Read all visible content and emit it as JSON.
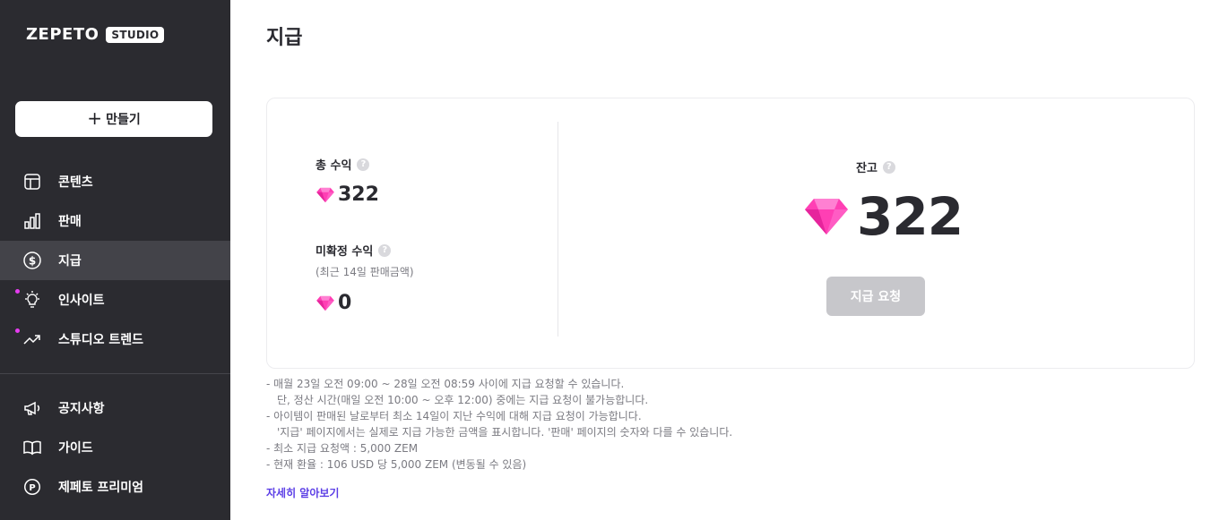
{
  "app": {
    "logo_word": "ZEPETO",
    "logo_badge": "STUDIO"
  },
  "sidebar": {
    "create_label": "만들기",
    "items": [
      {
        "label": "콘텐츠",
        "icon": "layout-icon"
      },
      {
        "label": "판매",
        "icon": "bar-chart-icon"
      },
      {
        "label": "지급",
        "icon": "dollar-circle-icon",
        "active": true
      },
      {
        "label": "인사이트",
        "icon": "lightbulb-icon",
        "dot": true
      },
      {
        "label": "스튜디오 트렌드",
        "icon": "trend-icon",
        "dot": true
      }
    ],
    "bottom_items": [
      {
        "label": "공지사항",
        "icon": "megaphone-icon"
      },
      {
        "label": "가이드",
        "icon": "book-icon"
      },
      {
        "label": "제페토 프리미엄",
        "icon": "premium-icon",
        "icon_text": "P"
      }
    ]
  },
  "page": {
    "title": "지급"
  },
  "card": {
    "total_label": "총 수익",
    "total_value": "322",
    "pending_label": "미확정 수익",
    "pending_sub": "(최근 14일 판매금액)",
    "pending_value": "0",
    "balance_label": "잔고",
    "balance_value": "322",
    "pay_button": "지급 요청",
    "help_glyph": "?"
  },
  "notes": [
    {
      "text": "- 매월 23일 오전 09:00 ~ 28일 오전 08:59 사이에 지급 요청할 수 있습니다.",
      "indent": false
    },
    {
      "text": "단, 정산 시간(매일 오전 10:00 ~ 오후 12:00) 중에는 지급 요청이 불가능합니다.",
      "indent": true
    },
    {
      "text": "- 아이템이 판매된 날로부터 최소 14일이 지난 수익에 대해 지급 요청이 가능합니다.",
      "indent": false
    },
    {
      "text": "'지급' 페이지에서는 실제로 지급 가능한 금액을 표시합니다. '판매' 페이지의 숫자와 다를 수 있습니다.",
      "indent": true
    },
    {
      "text": "- 최소 지급 요청액 : 5,000 ZEM",
      "indent": false
    },
    {
      "text": "- 현재 환율 : 106 USD 당 5,000 ZEM (변동될 수 있음)",
      "indent": false
    }
  ],
  "learn_more": "자세히 알아보기",
  "colors": {
    "sidebar_bg": "#2b2b30",
    "active_bg": "#434349",
    "accent_dot": "#e63cf0",
    "gem": "#ff3fb4",
    "link": "#5b3ee6",
    "disabled_button": "#c7c7cb"
  }
}
